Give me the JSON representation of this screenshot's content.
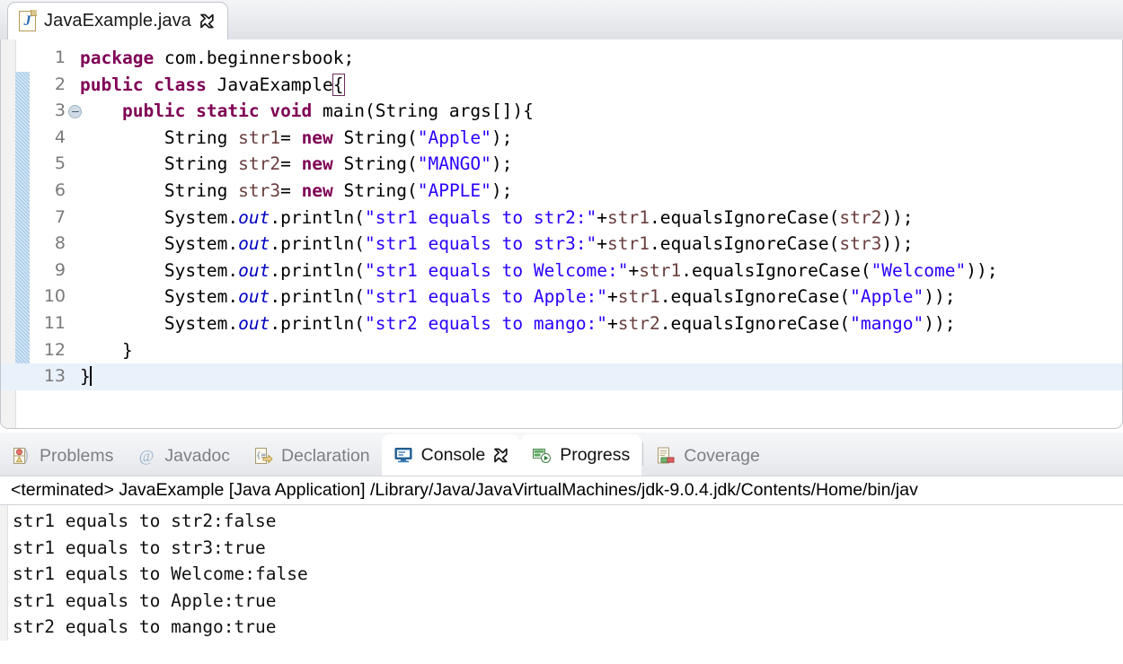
{
  "editor": {
    "tab": {
      "filename": "JavaExample.java",
      "file_icon": "java-file-icon",
      "close_icon": "close-icon"
    },
    "current_line": 13,
    "folded_marker_line": 3,
    "changed_lines_from": 2,
    "changed_lines_to": 13,
    "colors": {
      "keyword": "#7f0055",
      "string": "#2a00ff",
      "static_field": "#0000c0",
      "local_var": "#6a3e3e",
      "current_line_bg": "#e9f1fb",
      "change_bar": "#a8cbe8"
    },
    "lines": [
      {
        "n": "1",
        "tokens": [
          {
            "t": "package ",
            "c": "k"
          },
          {
            "t": "com.beginnersbook;",
            "c": "plain"
          }
        ]
      },
      {
        "n": "2",
        "tokens": [
          {
            "t": "public class ",
            "c": "k"
          },
          {
            "t": "JavaExample",
            "c": "plain"
          },
          {
            "t": "{",
            "c": "plain bracket-match"
          }
        ]
      },
      {
        "n": "3",
        "fold": true,
        "tokens": [
          {
            "t": "    ",
            "c": "plain"
          },
          {
            "t": "public static void ",
            "c": "k"
          },
          {
            "t": "main(String args[]){",
            "c": "plain"
          }
        ]
      },
      {
        "n": "4",
        "tokens": [
          {
            "t": "        String ",
            "c": "plain"
          },
          {
            "t": "str1",
            "c": "lv"
          },
          {
            "t": "= ",
            "c": "plain"
          },
          {
            "t": "new ",
            "c": "k"
          },
          {
            "t": "String(",
            "c": "plain"
          },
          {
            "t": "\"Apple\"",
            "c": "str"
          },
          {
            "t": ");",
            "c": "plain"
          }
        ]
      },
      {
        "n": "5",
        "tokens": [
          {
            "t": "        String ",
            "c": "plain"
          },
          {
            "t": "str2",
            "c": "lv"
          },
          {
            "t": "= ",
            "c": "plain"
          },
          {
            "t": "new ",
            "c": "k"
          },
          {
            "t": "String(",
            "c": "plain"
          },
          {
            "t": "\"MANGO\"",
            "c": "str"
          },
          {
            "t": ");",
            "c": "plain"
          }
        ]
      },
      {
        "n": "6",
        "tokens": [
          {
            "t": "        String ",
            "c": "plain"
          },
          {
            "t": "str3",
            "c": "lv"
          },
          {
            "t": "= ",
            "c": "plain"
          },
          {
            "t": "new ",
            "c": "k"
          },
          {
            "t": "String(",
            "c": "plain"
          },
          {
            "t": "\"APPLE\"",
            "c": "str"
          },
          {
            "t": ");",
            "c": "plain"
          }
        ]
      },
      {
        "n": "7",
        "tokens": [
          {
            "t": "        System.",
            "c": "plain"
          },
          {
            "t": "out",
            "c": "fld"
          },
          {
            "t": ".println(",
            "c": "plain"
          },
          {
            "t": "\"str1 equals to str2:\"",
            "c": "str"
          },
          {
            "t": "+",
            "c": "plain"
          },
          {
            "t": "str1",
            "c": "lv"
          },
          {
            "t": ".equalsIgnoreCase(",
            "c": "plain"
          },
          {
            "t": "str2",
            "c": "lv"
          },
          {
            "t": "));",
            "c": "plain"
          }
        ]
      },
      {
        "n": "8",
        "tokens": [
          {
            "t": "        System.",
            "c": "plain"
          },
          {
            "t": "out",
            "c": "fld"
          },
          {
            "t": ".println(",
            "c": "plain"
          },
          {
            "t": "\"str1 equals to str3:\"",
            "c": "str"
          },
          {
            "t": "+",
            "c": "plain"
          },
          {
            "t": "str1",
            "c": "lv"
          },
          {
            "t": ".equalsIgnoreCase(",
            "c": "plain"
          },
          {
            "t": "str3",
            "c": "lv"
          },
          {
            "t": "));",
            "c": "plain"
          }
        ]
      },
      {
        "n": "9",
        "tokens": [
          {
            "t": "        System.",
            "c": "plain"
          },
          {
            "t": "out",
            "c": "fld"
          },
          {
            "t": ".println(",
            "c": "plain"
          },
          {
            "t": "\"str1 equals to Welcome:\"",
            "c": "str"
          },
          {
            "t": "+",
            "c": "plain"
          },
          {
            "t": "str1",
            "c": "lv"
          },
          {
            "t": ".equalsIgnoreCase(",
            "c": "plain"
          },
          {
            "t": "\"Welcome\"",
            "c": "str"
          },
          {
            "t": "));",
            "c": "plain"
          }
        ]
      },
      {
        "n": "10",
        "tokens": [
          {
            "t": "        System.",
            "c": "plain"
          },
          {
            "t": "out",
            "c": "fld"
          },
          {
            "t": ".println(",
            "c": "plain"
          },
          {
            "t": "\"str1 equals to Apple:\"",
            "c": "str"
          },
          {
            "t": "+",
            "c": "plain"
          },
          {
            "t": "str1",
            "c": "lv"
          },
          {
            "t": ".equalsIgnoreCase(",
            "c": "plain"
          },
          {
            "t": "\"Apple\"",
            "c": "str"
          },
          {
            "t": "));",
            "c": "plain"
          }
        ]
      },
      {
        "n": "11",
        "tokens": [
          {
            "t": "        System.",
            "c": "plain"
          },
          {
            "t": "out",
            "c": "fld"
          },
          {
            "t": ".println(",
            "c": "plain"
          },
          {
            "t": "\"str2 equals to mango:\"",
            "c": "str"
          },
          {
            "t": "+",
            "c": "plain"
          },
          {
            "t": "str2",
            "c": "lv"
          },
          {
            "t": ".equalsIgnoreCase(",
            "c": "plain"
          },
          {
            "t": "\"mango\"",
            "c": "str"
          },
          {
            "t": "));",
            "c": "plain"
          }
        ]
      },
      {
        "n": "12",
        "tokens": [
          {
            "t": "    }",
            "c": "plain"
          }
        ]
      },
      {
        "n": "13",
        "current": true,
        "caret": true,
        "tokens": [
          {
            "t": "}",
            "c": "plain"
          }
        ]
      }
    ]
  },
  "bottom_panel": {
    "tabs": [
      {
        "label": "Problems",
        "icon": "problems-icon",
        "active": false
      },
      {
        "label": "Javadoc",
        "icon": "javadoc-icon",
        "active": false
      },
      {
        "label": "Declaration",
        "icon": "declaration-icon",
        "active": false
      },
      {
        "label": "Console",
        "icon": "console-icon",
        "active": true,
        "closable": true
      },
      {
        "label": "Progress",
        "icon": "progress-icon",
        "active": true
      },
      {
        "label": "Coverage",
        "icon": "coverage-icon",
        "active": false
      }
    ],
    "console": {
      "launch_line": "<terminated> JavaExample [Java Application] /Library/Java/JavaVirtualMachines/jdk-9.0.4.jdk/Contents/Home/bin/jav",
      "output": [
        "str1 equals to str2:false",
        "str1 equals to str3:true",
        "str1 equals to Welcome:false",
        "str1 equals to Apple:true",
        "str2 equals to mango:true"
      ]
    }
  }
}
